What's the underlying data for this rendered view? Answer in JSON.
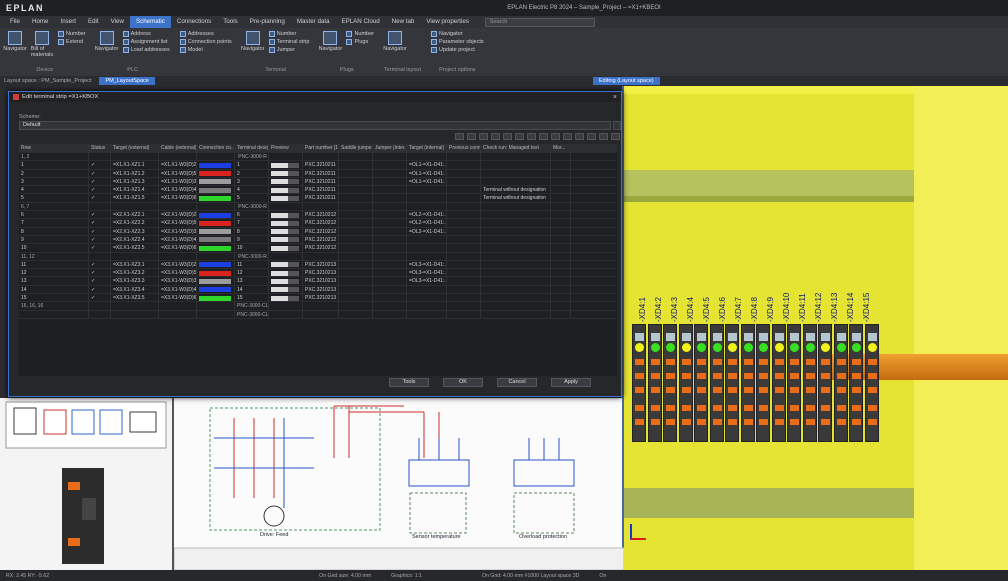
{
  "app": {
    "logo": "EPLAN",
    "window_title": "EPLAN Electric P8 2024 – Sample_Project – =X1+KBEOI"
  },
  "menu": {
    "items": [
      "File",
      "Home",
      "Insert",
      "Edit",
      "View",
      "Schematic",
      "Connections",
      "Tools",
      "Pre-planning",
      "Master data",
      "EPLAN Cloud",
      "New tab",
      "View properties"
    ],
    "active": "Schematic",
    "search_placeholder": "Search"
  },
  "ribbon": {
    "groups": [
      {
        "label": "Device",
        "big": [
          "Navigator",
          "Bill of materials"
        ],
        "small": [
          "Number",
          "Extend"
        ]
      },
      {
        "label": "PLC",
        "big": [
          "Navigator"
        ],
        "small": [
          "Address",
          "Assignment list",
          "Load addresses"
        ]
      },
      {
        "label": "",
        "big": [],
        "small": [
          "Addresses",
          "Connection points",
          "Model"
        ]
      },
      {
        "label": "Terminal",
        "big": [
          "Navigator"
        ],
        "small": [
          "Number",
          "Terminal strip",
          "Jumper"
        ]
      },
      {
        "label": "Plugs",
        "big": [
          "Navigator"
        ],
        "small": [
          "Number",
          "Plugs"
        ]
      },
      {
        "label": "Terminal layout",
        "big": [
          "Navigator"
        ],
        "small": []
      },
      {
        "label": "Project options",
        "big": [],
        "small": [
          "Navigator",
          "Parameter objects",
          "Update project"
        ]
      }
    ]
  },
  "addressbar": {
    "label": "Layout space : PM_Sample_Project",
    "tab1": "PM_LayoutSpace",
    "tab2": "Editing (Layout space)"
  },
  "dialog": {
    "title": "Edit terminal strip =X1+KBOX",
    "scheme_label": "Scheme:",
    "scheme_value": "Default",
    "close": "×",
    "columns": [
      "Row",
      "Status",
      "Target (external)",
      "Cable (external)",
      "Connection co...",
      "Terminal desig...",
      "Preview",
      "Part number [1]",
      "Saddle jumper...",
      "Jumper (inter...",
      "Target (internal)",
      "Previous conne...",
      "Check run: Managed text",
      "Mor..."
    ],
    "rows": [
      {
        "row": "1, 2",
        "status": "",
        "te": "",
        "ce": "",
        "color": "",
        "td": "PNC-3000-R",
        "part": "",
        "tint": "",
        "check": "",
        "group": true
      },
      {
        "row": "1",
        "status": "✓",
        "te": "=X1.X1-XZ1.1",
        "ce": "=X1.X1-W3(D)2",
        "color": "#1b3fe0",
        "td": "1",
        "part": "PXC.3210211",
        "tint": "=OL1-=X1-D41:...",
        "check": "",
        "group": false
      },
      {
        "row": "2",
        "status": "✓",
        "te": "=X1.X1-XZ1.2",
        "ce": "=X1.X1-W3(D)5",
        "color": "#d8231f",
        "td": "2",
        "part": "PXC.3210211",
        "tint": "=OL1-=X1-D41:...",
        "check": "",
        "group": false
      },
      {
        "row": "3",
        "status": "✓",
        "te": "=X1.X1-XZ1.3",
        "ce": "=X1.X1-W3(D)3",
        "color": "#9c9c9c",
        "td": "3",
        "part": "PXC.3210211",
        "tint": "=OL1-=X1-D41:...",
        "check": "",
        "group": false
      },
      {
        "row": "4",
        "status": "✓",
        "te": "=X1.X1-XZ1.4",
        "ce": "=X1.X1-W3(D)4",
        "color": "#7a7a7a",
        "td": "4",
        "part": "PXC.3210211",
        "tint": "",
        "check": "Terminal without designation",
        "group": false
      },
      {
        "row": "5",
        "status": "✓",
        "te": "=X1.X1-XZ1.5",
        "ce": "=X1.X1-W3(D)6",
        "color": "#2fd62a",
        "td": "5",
        "part": "PXC.3210211",
        "tint": "",
        "check": "Terminal without designation",
        "group": false
      },
      {
        "row": "6, 7",
        "status": "",
        "te": "",
        "ce": "",
        "color": "",
        "td": "PNC-3000-R",
        "part": "",
        "tint": "",
        "check": "",
        "group": true
      },
      {
        "row": "6",
        "status": "✓",
        "te": "=X2.X1-XZ2.1",
        "ce": "=X2.X1-W3(D)2",
        "color": "#1b3fe0",
        "td": "6",
        "part": "PXC.3210212",
        "tint": "=OL2-=X1-D41:...",
        "check": "",
        "group": false
      },
      {
        "row": "7",
        "status": "✓",
        "te": "=X2.X1-XZ2.2",
        "ce": "=X2.X1-W3(D)5",
        "color": "#d8231f",
        "td": "7",
        "part": "PXC.3210212",
        "tint": "=OL2-=X1-D41:...",
        "check": "",
        "group": false
      },
      {
        "row": "8",
        "status": "✓",
        "te": "=X2.X1-XZ2.3",
        "ce": "=X2.X1-W3(D)3",
        "color": "#9c9c9c",
        "td": "8",
        "part": "PXC.3210212",
        "tint": "=OL2-=X1-D41:...",
        "check": "",
        "group": false
      },
      {
        "row": "9",
        "status": "✓",
        "te": "=X2.X1-XZ2.4",
        "ce": "=X2.X1-W3(D)4",
        "color": "#7a7a7a",
        "td": "9",
        "part": "PXC.3210212",
        "tint": "",
        "check": "",
        "group": false
      },
      {
        "row": "10",
        "status": "✓",
        "te": "=X2.X1-XZ2.5",
        "ce": "=X2.X1-W3(D)6",
        "color": "#2fd62a",
        "td": "10",
        "part": "PXC.3210212",
        "tint": "",
        "check": "",
        "group": false
      },
      {
        "row": "11, 12",
        "status": "",
        "te": "",
        "ce": "",
        "color": "",
        "td": "PNC-3000-R",
        "part": "",
        "tint": "",
        "check": "",
        "group": true
      },
      {
        "row": "11",
        "status": "✓",
        "te": "=X3.X1-XZ3.1",
        "ce": "=X3.X1-W3(D)2",
        "color": "#1b3fe0",
        "td": "11",
        "part": "PXC.3210213",
        "tint": "=OL3-=X1-D41:...",
        "check": "",
        "group": false
      },
      {
        "row": "12",
        "status": "✓",
        "te": "=X3.X1-XZ3.2",
        "ce": "=X3.X1-W3(D)5",
        "color": "#d8231f",
        "td": "12",
        "part": "PXC.3210213",
        "tint": "=OL3-=X1-D41:...",
        "check": "",
        "group": false
      },
      {
        "row": "13",
        "status": "✓",
        "te": "=X3.X1-XZ3.3",
        "ce": "=X3.X1-W3(D)3",
        "color": "#9c9c9c",
        "td": "13",
        "part": "PXC.3210213",
        "tint": "=OL3-=X1-D41:...",
        "check": "",
        "group": false
      },
      {
        "row": "14",
        "status": "✓",
        "te": "=X3.X1-XZ3.4",
        "ce": "=X3.X1-W3(D)4",
        "color": "#1b3fe0",
        "td": "14",
        "part": "PXC.3210213",
        "tint": "",
        "check": "",
        "group": false
      },
      {
        "row": "15",
        "status": "✓",
        "te": "=X3.X1-XZ3.5",
        "ce": "=X3.X1-W3(D)6",
        "color": "#2fd62a",
        "td": "15",
        "part": "PXC.3210213",
        "tint": "",
        "check": "",
        "group": false
      },
      {
        "row": "16, 16, 16",
        "status": "",
        "te": "",
        "ce": "",
        "color": "",
        "td": "PNC-3000-CLMP",
        "part": "",
        "tint": "",
        "check": "",
        "group": true
      },
      {
        "row": "",
        "status": "",
        "te": "",
        "ce": "",
        "color": "",
        "td": "PNC-3000-CLMP",
        "part": "",
        "tint": "",
        "check": "",
        "group": true
      }
    ],
    "buttons": {
      "tools": "Tools",
      "ok": "OK",
      "cancel": "Cancel",
      "apply": "Apply"
    }
  },
  "view3d": {
    "labels": [
      "-XD4:1",
      "-XD4:2",
      "-XD4:3",
      "-XD4:4",
      "-XD4:5",
      "-XD4:6",
      "-XD4:7",
      "-XD4:8",
      "-XD4:9",
      "-XD4:10",
      "-XD4:11",
      "-XD4:12",
      "-XD4:13",
      "-XD4:14",
      "-XD4:15"
    ]
  },
  "schematic": {
    "captions": [
      "Drive: Feed",
      "Sensor temperature",
      "Overload protection"
    ]
  },
  "statusbar": {
    "left": "RX: 2.45 RY: -5.62",
    "mid": "On   Grid size: 4.00 mm",
    "mid2": "Graphics: 1:1",
    "right": "On   Grid: 4.00 mm  #1000 Layout space 3D",
    "far": "On"
  }
}
